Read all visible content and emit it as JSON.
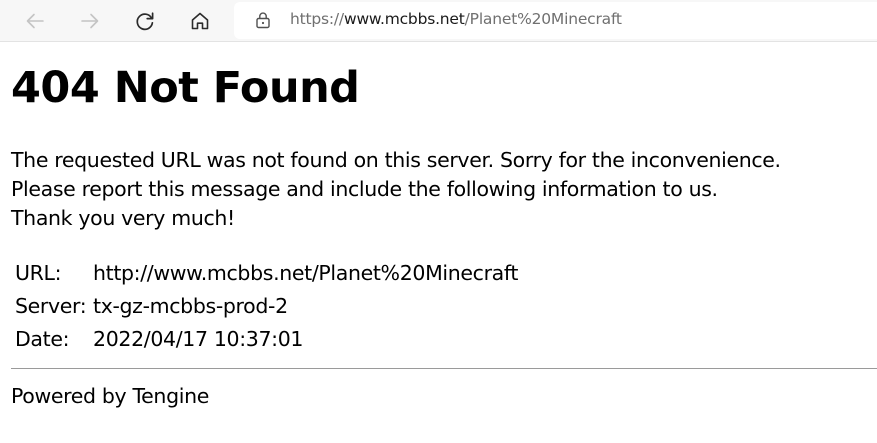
{
  "browser": {
    "url_scheme": "https://",
    "url_host": "www.mcbbs.net",
    "url_path": "/Planet%20Minecraft",
    "icons": [
      "back-arrow-icon",
      "forward-arrow-icon",
      "refresh-icon",
      "home-icon",
      "lock-icon"
    ]
  },
  "page": {
    "heading": "404 Not Found",
    "message_lines": [
      "The requested URL was not found on this server. Sorry for the inconvenience.",
      "Please report this message and include the following information to us.",
      "Thank you very much!"
    ],
    "info": [
      {
        "label": "URL:",
        "value": "http://www.mcbbs.net/Planet%20Minecraft"
      },
      {
        "label": "Server:",
        "value": "tx-gz-mcbbs-prod-2"
      },
      {
        "label": "Date:",
        "value": "2022/04/17 10:37:01"
      }
    ],
    "footer": "Powered by Tengine"
  }
}
